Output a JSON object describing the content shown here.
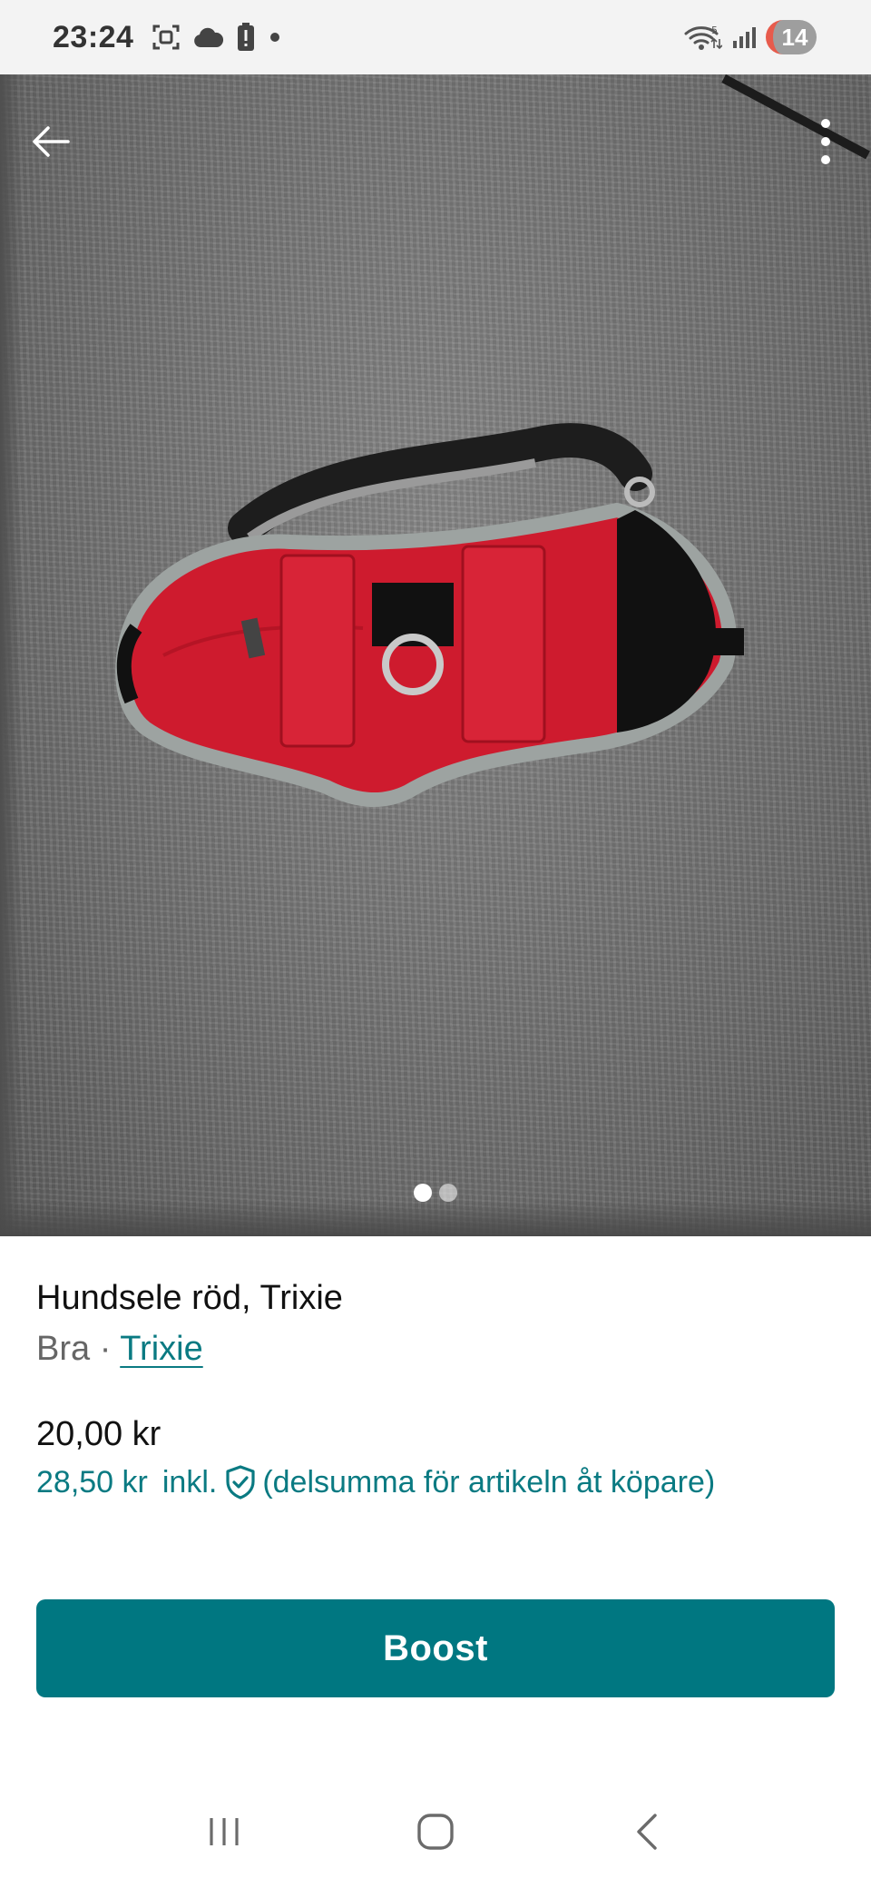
{
  "status_bar": {
    "time": "23:24",
    "notification_badge": "14",
    "icons": [
      "screenshot-icon",
      "cloud-icon",
      "battery-alert-icon",
      "dot-icon",
      "wifi-icon",
      "signal-icon"
    ]
  },
  "gallery": {
    "image_count": 2,
    "active_index": 0,
    "image_description": "red dog harness on grey sofa"
  },
  "listing": {
    "title": "Hundsele röd, Trixie",
    "condition": "Bra",
    "separator": " · ",
    "brand": "Trixie",
    "price": "20,00 kr",
    "total_price": "28,50 kr",
    "incl": "inkl.",
    "buyer_note": "(delsumma för artikeln åt köpare)"
  },
  "actions": {
    "boost_label": "Boost"
  },
  "colors": {
    "accent": "#007781",
    "link": "#0a7a82",
    "badge_bg": "#9e9e9e",
    "badge_edge": "#e75b4c"
  }
}
